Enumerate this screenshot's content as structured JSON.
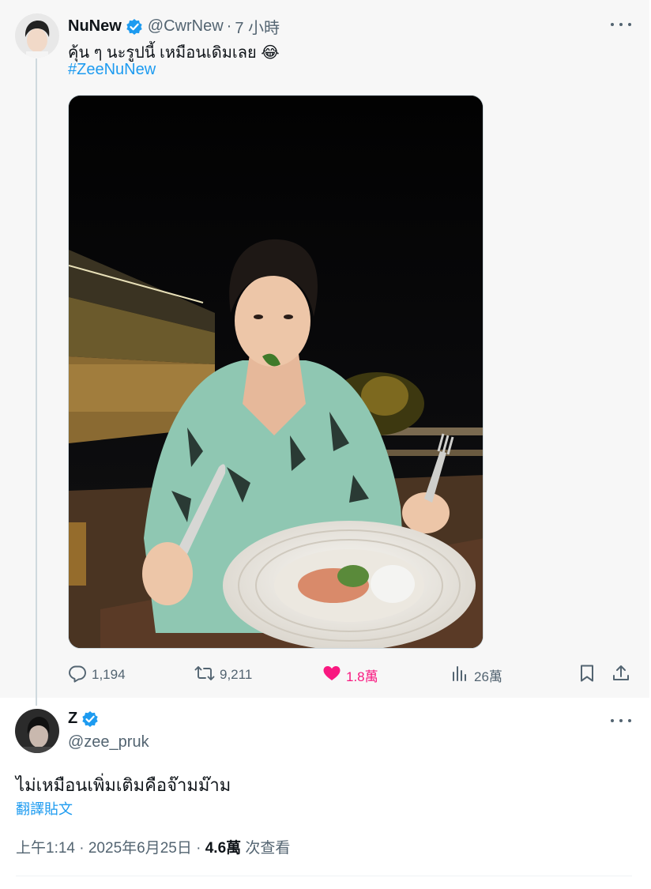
{
  "parent_tweet": {
    "display_name": "NuNew",
    "handle": "@CwrNew",
    "separator": "·",
    "time": "7 小時",
    "text": "คุ้น ๆ นะรูปนี้ เหมือนเดิมเลย 😂",
    "hashtag": "#ZeeNuNew",
    "actions": {
      "replies": "1,194",
      "retweets": "9,211",
      "likes": "1.8萬",
      "views": "26萬"
    }
  },
  "reply_tweet": {
    "display_name": "Z",
    "handle": "@zee_pruk",
    "text": "ไม่เหมือนเพิ่มเติมคือจ๊ามม๊าม",
    "translate_label": "翻譯貼文",
    "timestamp": "上午1:14 · 2025年6月25日 · ",
    "views_count": "4.6萬",
    "views_label": " 次查看"
  },
  "colors": {
    "accent": "#1d9bf0",
    "like": "#f91880",
    "muted": "#536471"
  }
}
